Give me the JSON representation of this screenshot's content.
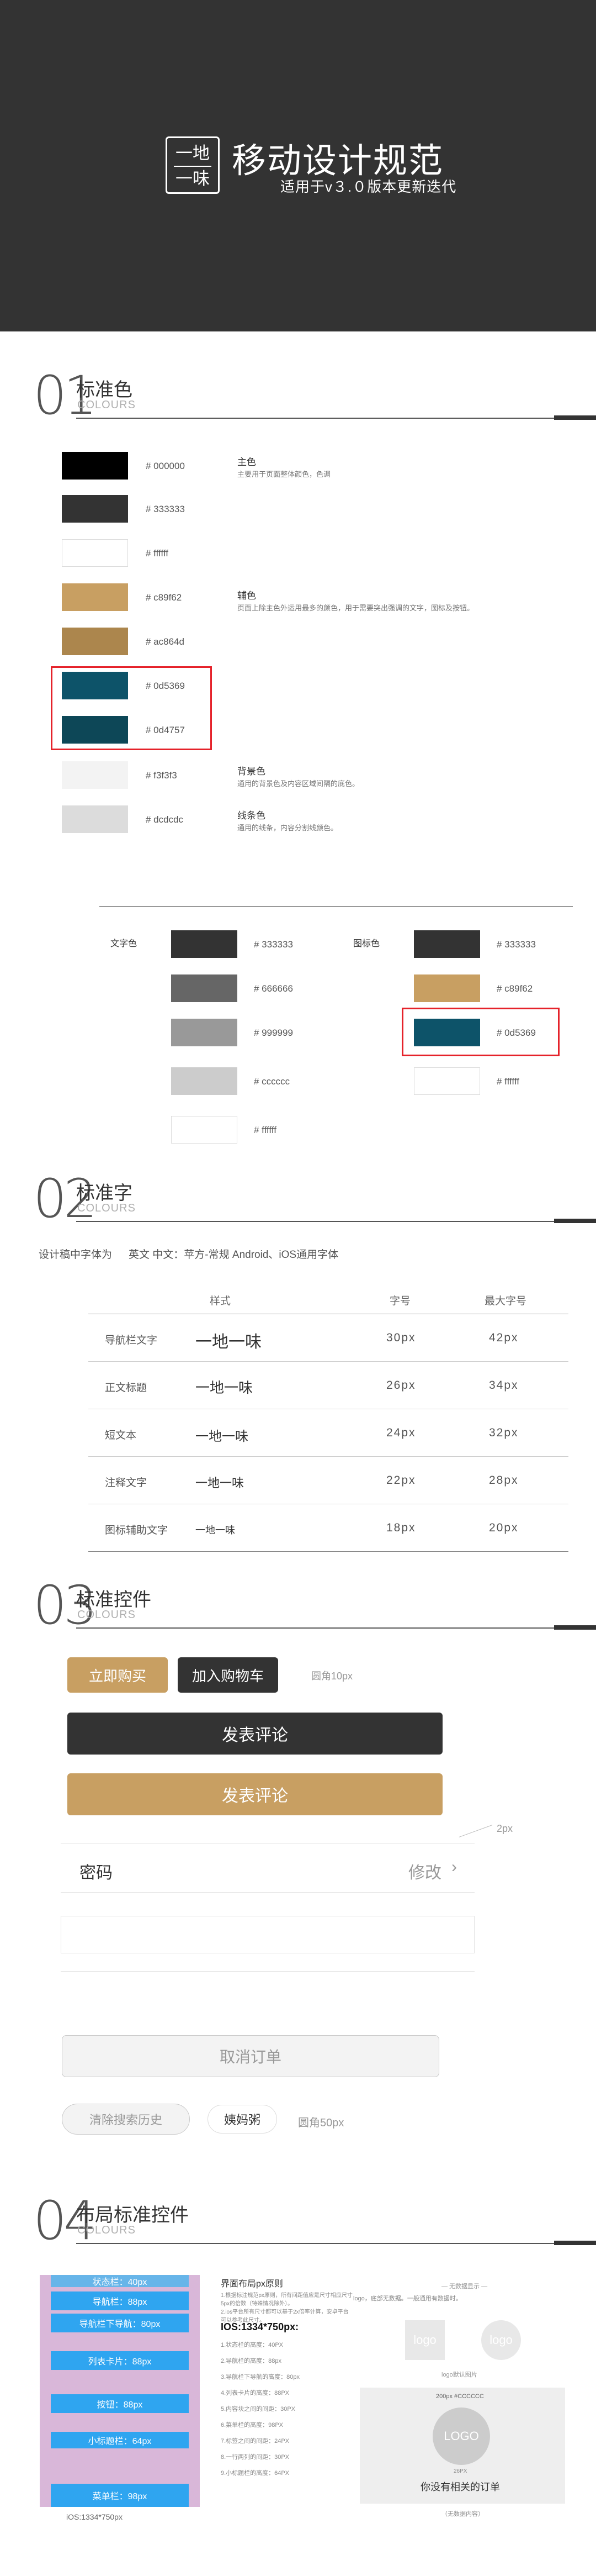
{
  "header": {
    "logo_line1": "一地",
    "logo_line2": "一味",
    "title": "移动设计规范",
    "subtitle": "适用于v３.０版本更新迭代"
  },
  "sections": [
    {
      "num": "01",
      "title": "标准色",
      "en": "COLOURS"
    },
    {
      "num": "02",
      "title": "标准字",
      "en": "COLOURS"
    },
    {
      "num": "03",
      "title": "标准控件",
      "en": "COLOURS"
    },
    {
      "num": "04",
      "title": "布局标准控件",
      "en": "COLOURS"
    }
  ],
  "colors": {
    "swatches": [
      {
        "hex": "#000000",
        "label": "# 000000"
      },
      {
        "hex": "#333333",
        "label": "# 333333"
      },
      {
        "hex": "#ffffff",
        "label": "# ffffff"
      },
      {
        "hex": "#c89f62",
        "label": "# c89f62"
      },
      {
        "hex": "#ac864d",
        "label": "# ac864d"
      },
      {
        "hex": "#0d5369",
        "label": "# 0d5369"
      },
      {
        "hex": "#0d4757",
        "label": "# 0d4757"
      },
      {
        "hex": "#f3f3f3",
        "label": "# f3f3f3"
      },
      {
        "hex": "#dcdcdc",
        "label": "# dcdcdc"
      }
    ],
    "groups": [
      {
        "name": "主色",
        "desc": "主要用于页面整体颜色，色调"
      },
      {
        "name": "辅色",
        "desc": "页面上除主色外运用最多的颜色，用于需要突出强调的文字，图标及按钮。"
      },
      {
        "name": "背景色",
        "desc": "通用的背景色及内容区域间隔的底色。"
      },
      {
        "name": "线条色",
        "desc": "通用的线条，内容分割线颜色。"
      }
    ],
    "text_label": "文字色",
    "text_swatches": [
      {
        "hex": "#333333",
        "label": "# 333333"
      },
      {
        "hex": "#666666",
        "label": "# 666666"
      },
      {
        "hex": "#999999",
        "label": "# 999999"
      },
      {
        "hex": "#cccccc",
        "label": "# cccccc"
      },
      {
        "hex": "#ffffff",
        "label": "# ffffff"
      }
    ],
    "icon_label": "图标色",
    "icon_swatches": [
      {
        "hex": "#333333",
        "label": "# 333333"
      },
      {
        "hex": "#c89f62",
        "label": "# c89f62"
      },
      {
        "hex": "#0d5369",
        "label": "# 0d5369"
      },
      {
        "hex": "#ffffff",
        "label": "# ffffff"
      }
    ]
  },
  "typography": {
    "intro_label": "设计稿中字体为",
    "intro_value": "英文 中文：苹方-常规  Android、iOS通用字体",
    "headers": [
      "样式",
      "字号",
      "最大字号"
    ],
    "rows": [
      {
        "name": "导航栏文字",
        "sample": "一地一味",
        "size": "30px",
        "max": "42px"
      },
      {
        "name": "正文标题",
        "sample": "一地一味",
        "size": "26px",
        "max": "34px"
      },
      {
        "name": "短文本",
        "sample": "一地一味",
        "size": "24px",
        "max": "32px"
      },
      {
        "name": "注释文字",
        "sample": "一地一味",
        "size": "22px",
        "max": "28px"
      },
      {
        "name": "图标辅助文字",
        "sample": "一地一味",
        "size": "18px",
        "max": "20px"
      }
    ]
  },
  "controls": {
    "buy_now": "立即购买",
    "add_cart": "加入购物车",
    "radius_note": "圆角10px",
    "comment_dark": "发表评论",
    "comment_gold": "发表评论",
    "px_note": "2px",
    "password_label": "密码",
    "modify_label": "修改",
    "cancel_order": "取消订单",
    "clear_history": "清除搜索历史",
    "tag_name": "姨妈粥",
    "pill_radius": "圆角50px"
  },
  "layout": {
    "bands": [
      "状态栏：40px",
      "导航栏：88px",
      "导航栏下导航：80px",
      "列表卡片：88px",
      "按钮：88px",
      "小标题栏：64px",
      "菜单栏：98px"
    ],
    "caption": "iOS:1334*750px",
    "rule_title": "界面布局px原则",
    "rule_1": "1.根据标注规范px原则，所有间距值应是尺寸相应尺寸5px的倍数（特殊情况除外）。",
    "rule_2": "2.ios平台所有尺寸都可以基于2x倍率计算，安卓平台可以参考此尺寸。",
    "ios_title": "IOS:1334*750px:",
    "ios_items": [
      "1.状态栏的高度：40PX",
      "2.导航栏的高度：88px",
      "3.导航栏下导航的高度：80px",
      "4.列表卡片的高度：88PX",
      "5.内容块之间的间距：30PX",
      "6.菜单栏的高度：98PX",
      "7.标签之间的间距：24PX",
      "8.一行两列的间距：30PX",
      "9.小标题栏的高度：64PX"
    ],
    "empty_title": "— 无数据显示 —",
    "empty_desc": "logo，底部无数据。一般通用有数据时。",
    "logo_text": "logo",
    "logo_caption": "logo默认图片",
    "empty_card_text": "你没有相关的订单",
    "empty_card_note": "200px #CCCCCC",
    "empty_card_logo": "LOGO",
    "empty_card_sub": "26PX",
    "empty_caption": "（无数据内容）"
  }
}
